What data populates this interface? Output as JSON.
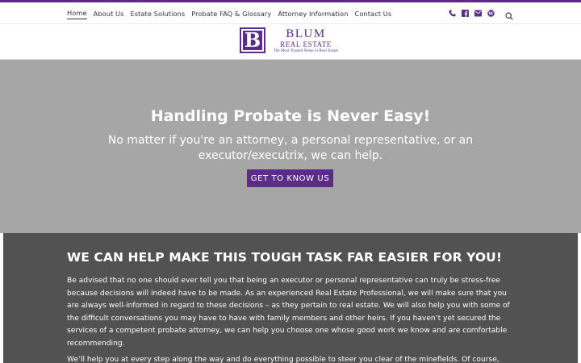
{
  "nav": {
    "links": [
      {
        "label": "Home",
        "active": true
      },
      {
        "label": "About Us"
      },
      {
        "label": "Estate Solutions"
      },
      {
        "label": "Probate FAQ & Glossary"
      },
      {
        "label": "Attorney Information"
      },
      {
        "label": "Contact Us"
      }
    ],
    "icons": [
      "phone-icon",
      "facebook-icon",
      "email-icon",
      "wordpress-icon",
      "search-icon"
    ]
  },
  "logo": {
    "mark": "B",
    "name": "BLUM",
    "subtitle": "REAL ESTATE",
    "tagline": "The Most Trusted Name in Real Estate"
  },
  "hero": {
    "title": "Handling Probate is Never Easy!",
    "subtitle": "No matter if you're an attorney, a personal representative, or an executor/executrix, we can help.",
    "button_label": "GET TO KNOW US"
  },
  "content": {
    "title": "WE CAN HELP MAKE THIS TOUGH TASK FAR EASIER FOR YOU!",
    "paragraph1": "Be advised that no one should ever tell you that being an executor or personal representative can truly be stress-free because decisions will indeed have to be made. As an experienced Real Estate Professional, we will make sure that you are always well-informed in regard to these decisions – as they pertain to real estate. We will also help you with some of the difficult conversations you may have to have with family members and other heirs. If you haven’t yet secured the services of a competent probate attorney, we can help you choose one whose good work we know and are comfortable recommending.",
    "paragraph2": "We’ll help you at every step along the way and do everything possible to steer you clear of the minefields. Of course,"
  },
  "colors": {
    "brand": "#5b2d86",
    "hero_bg": "#a6a6a6",
    "content_bg": "#525252"
  }
}
